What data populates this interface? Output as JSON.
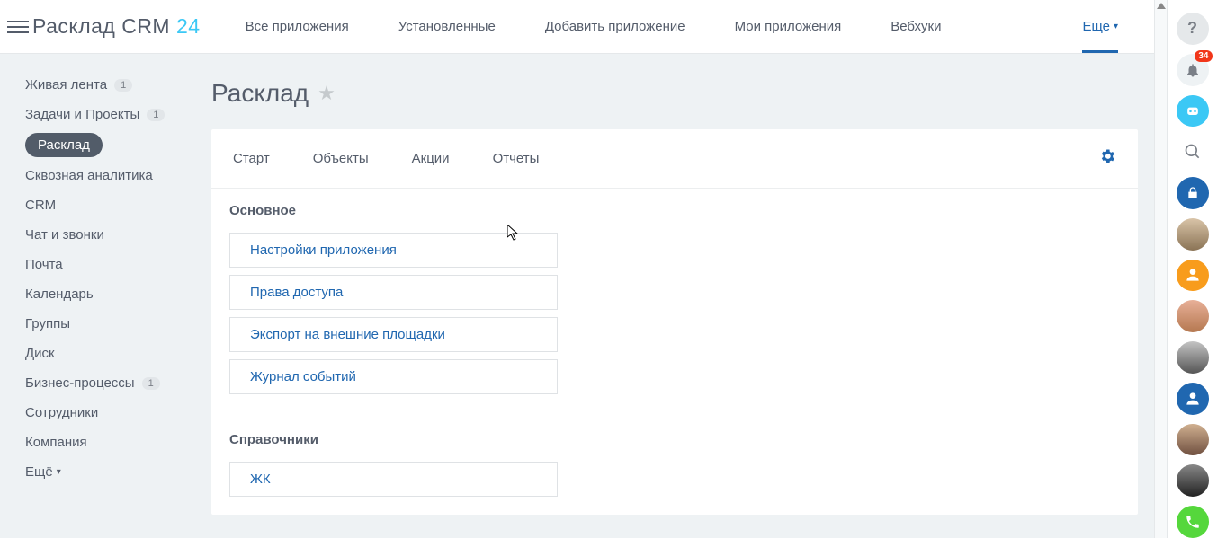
{
  "brand": {
    "name": "Расклад CRM",
    "suffix": "24"
  },
  "topnav": {
    "items": [
      "Все приложения",
      "Установленные",
      "Добавить приложение",
      "Мои приложения",
      "Вебхуки"
    ],
    "more": "Еще"
  },
  "sidebar": {
    "items": [
      {
        "label": "Живая лента",
        "badge": "1"
      },
      {
        "label": "Задачи и Проекты",
        "badge": "1"
      },
      {
        "label": "Расклад",
        "active": true
      },
      {
        "label": "Сквозная аналитика"
      },
      {
        "label": "CRM"
      },
      {
        "label": "Чат и звонки"
      },
      {
        "label": "Почта"
      },
      {
        "label": "Календарь"
      },
      {
        "label": "Группы"
      },
      {
        "label": "Диск"
      },
      {
        "label": "Бизнес-процессы",
        "badge": "1"
      },
      {
        "label": "Сотрудники"
      },
      {
        "label": "Компания"
      }
    ],
    "more": "Ещё"
  },
  "page": {
    "title": "Расклад"
  },
  "inner_tabs": [
    "Старт",
    "Объекты",
    "Акции",
    "Отчеты"
  ],
  "sections": [
    {
      "title": "Основное",
      "links": [
        "Настройки приложения",
        "Права доступа",
        "Экспорт на внешние площадки",
        "Журнал событий"
      ]
    },
    {
      "title": "Справочники",
      "links": [
        "ЖК"
      ]
    }
  ],
  "rightbar": {
    "notif_count": "34"
  }
}
